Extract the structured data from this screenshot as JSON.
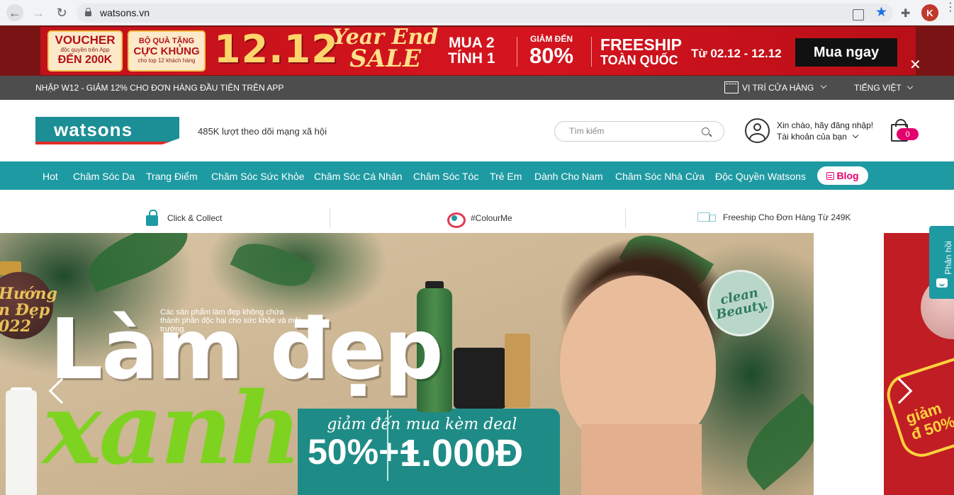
{
  "browser": {
    "url": "watsons.vn",
    "avatar_letter": "K"
  },
  "promo": {
    "voucher_title": "VOUCHER",
    "voucher_note": "độc quyền trên App",
    "voucher_value": "ĐẾN 200K",
    "gift_line1": "BỘ QUÀ TẶNG",
    "gift_line2": "CỰC KHỦNG",
    "gift_note": "cho top 12 khách hàng",
    "date": "12.12",
    "sale_line1": "Year End",
    "sale_line2": "SALE",
    "mua2_line1": "MUA 2",
    "mua2_line2": "TÍNH 1",
    "discount_label": "GIẢM ĐẾN",
    "discount_value": "80%",
    "freeship_line1": "FREESHIP",
    "freeship_line2": "TOÀN QUỐC",
    "dates": "Từ 02.12 - 12.12",
    "cta": "Mua ngay",
    "close": "✕",
    "accent": "#d5141e"
  },
  "infobar": {
    "message": "NHẬP W12 - GIẢM 12% CHO ĐƠN HÀNG ĐẦU TIÊN TRÊN APP",
    "store_locator": "VỊ TRÍ CỬA HÀNG",
    "language": "TIẾNG VIỆT"
  },
  "header": {
    "logo": "watsons",
    "followers": "485K lượt theo dõi mạng xã hội",
    "search_placeholder": "Tìm kiếm",
    "greeting": "Xin chào, hãy đăng nhập!",
    "account": "Tài khoản của bạn",
    "cart_count": "0",
    "brand_color": "#1e9aa3"
  },
  "nav": {
    "items": [
      "Hot",
      "Chăm Sóc Da",
      "Trang Điểm",
      "Chăm Sóc Sức Khỏe",
      "Chăm Sóc Cá Nhân",
      "Chăm Sóc Tóc",
      "Trẻ Em",
      "Dành Cho Nam",
      "Chăm Sóc Nhà Cửa",
      "Độc Quyền Watsons"
    ],
    "blog": "Blog"
  },
  "services": {
    "click_collect": "Click & Collect",
    "colour_me": "#ColourMe",
    "freeship": "Freeship Cho Đơn Hàng Từ 249K"
  },
  "hero": {
    "ornament_text_1": "Hướng",
    "ornament_text_2": "n Đẹp",
    "ornament_text_3": "022",
    "subtitle": "Các sản phẩm làm đẹp không chứa thành phần độc hại cho sức khỏe và môi trường.",
    "headline": "Làm đẹp",
    "headline_2": "xanh",
    "offer1_label": "giảm đến",
    "offer1_value": "50%++",
    "offer2_label": "mua kèm deal",
    "offer2_value": "1.000Đ",
    "badge": "clean Beauty.",
    "peek_text": "giảm đ 50%"
  },
  "feedback": {
    "label": "Phản hồi"
  }
}
